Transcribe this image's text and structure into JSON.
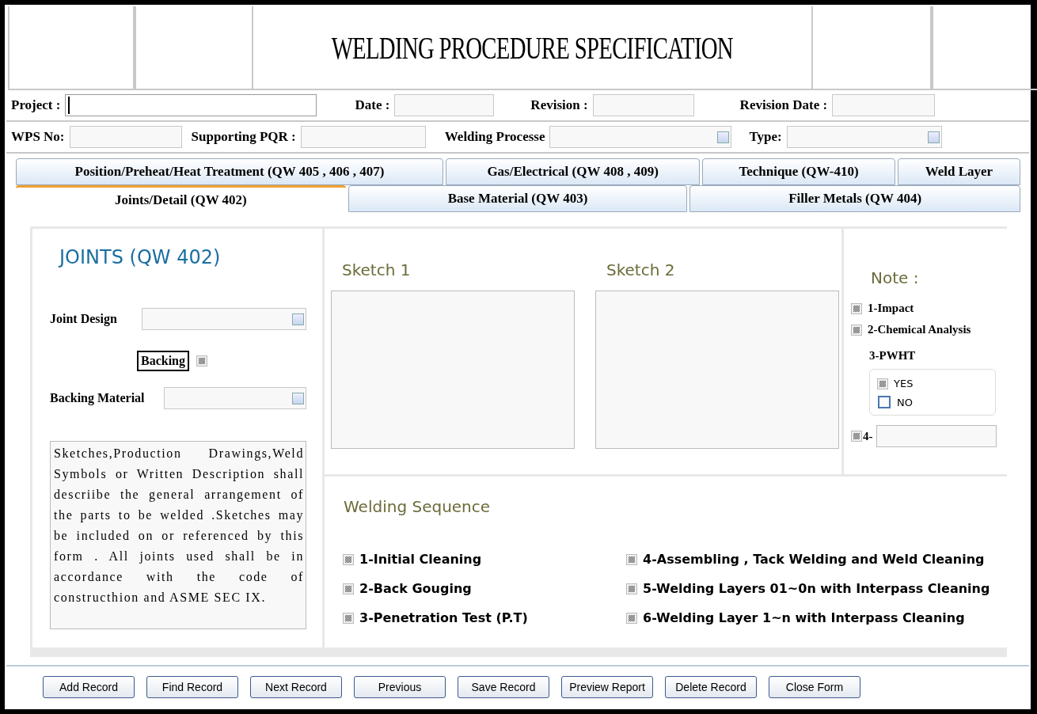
{
  "header": {
    "title": "WELDING PROCEDURE SPECIFICATION"
  },
  "fields_row_1": [
    {
      "label": "Project :",
      "kind": "text",
      "focused": true
    },
    {
      "label": "Date :",
      "kind": "text",
      "focused": false
    },
    {
      "label": "Revision :",
      "kind": "text",
      "focused": false
    },
    {
      "label": "Revision Date :",
      "kind": "text",
      "focused": false
    }
  ],
  "fields_row_2": [
    {
      "label": "WPS No:",
      "kind": "text",
      "focused": false
    },
    {
      "label": "Supporting PQR :",
      "kind": "text",
      "focused": false
    },
    {
      "label": "Welding Processe",
      "kind": "combo",
      "focused": false
    },
    {
      "label": "Type:",
      "kind": "combo",
      "focused": false
    }
  ],
  "tabs_row_1": [
    {
      "label": "Position/Preheat/Heat Treatment (QW 405 , 406 , 407)",
      "selected": false
    },
    {
      "label": "Gas/Electrical (QW 408 , 409)",
      "selected": false
    },
    {
      "label": "Technique (QW-410)",
      "selected": false
    },
    {
      "label": "Weld Layer",
      "selected": false
    }
  ],
  "tabs_row_2": [
    {
      "label": "Joints/Detail (QW 402)",
      "selected": true
    },
    {
      "label": "Base Material (QW 403)",
      "selected": false
    },
    {
      "label": "Filler Metals (QW 404)",
      "selected": false
    }
  ],
  "joints": {
    "title": "JOINTS (QW 402)",
    "joint_design_label": "Joint Design",
    "backing_label": "Backing",
    "backing_indeterminate": true,
    "backing_material_label": "Backing Material",
    "description": "Sketches,Production Drawings,Weld Symbols or Written Description shall descriibe the general arrangement of the parts to be welded .Sketches may be included on or referenced by this form . All joints used shall be in accordance with the code of constructhion and ASME SEC IX."
  },
  "sketches": [
    {
      "title": "Sketch 1"
    },
    {
      "title": "Sketch 2"
    }
  ],
  "note": {
    "title": "Note :",
    "items": [
      {
        "label": "1-Impact",
        "indeterminate": true
      },
      {
        "label": "2-Chemical Analysis",
        "indeterminate": true
      }
    ],
    "pwht_label": "3-PWHT",
    "pwht_options": [
      {
        "label": "YES",
        "indeterminate": true
      },
      {
        "label": "NO",
        "indeterminate": false
      }
    ],
    "other_label": "4-",
    "other_indeterminate": true
  },
  "welding_sequence": {
    "title": "Welding Sequence",
    "items": [
      {
        "label": "1-Initial Cleaning",
        "indeterminate": true
      },
      {
        "label": "2-Back Gouging",
        "indeterminate": true
      },
      {
        "label": "3-Penetration Test (P.T)",
        "indeterminate": true
      },
      {
        "label": "4-Assembling , Tack Welding and Weld Cleaning",
        "indeterminate": true
      },
      {
        "label": "5-Welding Layers 01~0n with Interpass Cleaning",
        "indeterminate": true
      },
      {
        "label": "6-Welding Layer 1~n with Interpass Cleaning",
        "indeterminate": true
      }
    ]
  },
  "buttons": [
    "Add Record",
    "Find Record",
    "Next Record",
    "Previous",
    "Save Record",
    "Preview Report",
    "Delete Record",
    "Close Form"
  ]
}
